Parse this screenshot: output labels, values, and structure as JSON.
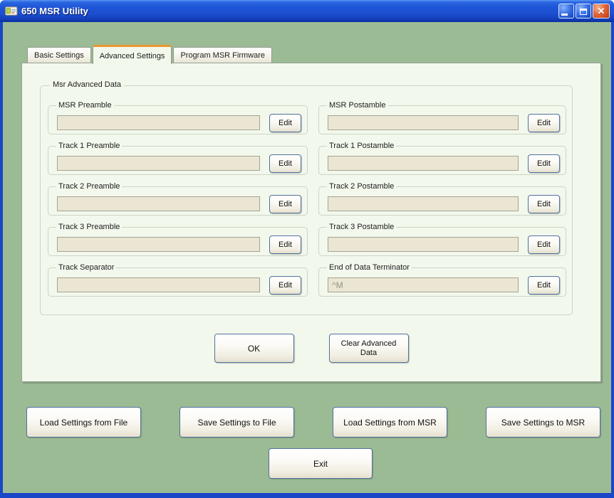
{
  "window": {
    "title": "650 MSR Utility",
    "controls": {
      "close_glyph": "✕"
    }
  },
  "tabs": [
    {
      "label": "Basic Settings",
      "active": false
    },
    {
      "label": "Advanced Settings",
      "active": true
    },
    {
      "label": "Program MSR Firmware",
      "active": false
    }
  ],
  "advanced_tab": {
    "group_title": "Msr Advanced Data",
    "fields": [
      {
        "label": "MSR Preamble",
        "value": "",
        "button": "Edit"
      },
      {
        "label": "MSR Postamble",
        "value": "",
        "button": "Edit"
      },
      {
        "label": "Track 1 Preamble",
        "value": "",
        "button": "Edit"
      },
      {
        "label": "Track 1 Postamble",
        "value": "",
        "button": "Edit"
      },
      {
        "label": "Track 2 Preamble",
        "value": "",
        "button": "Edit"
      },
      {
        "label": "Track 2 Postamble",
        "value": "",
        "button": "Edit"
      },
      {
        "label": "Track 3 Preamble",
        "value": "",
        "button": "Edit"
      },
      {
        "label": "Track 3 Postamble",
        "value": "",
        "button": "Edit"
      },
      {
        "label": "Track Separator",
        "value": "",
        "button": "Edit"
      },
      {
        "label": "End of Data Terminator",
        "value": "^M",
        "button": "Edit"
      }
    ],
    "ok_label": "OK",
    "clear_label": "Clear Advanced Data"
  },
  "bottom_buttons": [
    {
      "label": "Load Settings from File"
    },
    {
      "label": "Save Settings to File"
    },
    {
      "label": "Load Settings from MSR"
    },
    {
      "label": "Save Settings to MSR"
    }
  ],
  "exit_label": "Exit",
  "colors": {
    "titlebar_blue": "#1e54d6",
    "window_frame": "#1a46c8",
    "client_green": "#9bbb94",
    "tab_page_bg": "#f2f8ec",
    "field_bg": "#ebe6d3",
    "active_tab_accent": "#e9962e",
    "close_button_red": "#cc4418",
    "button_border": "#52709e"
  }
}
